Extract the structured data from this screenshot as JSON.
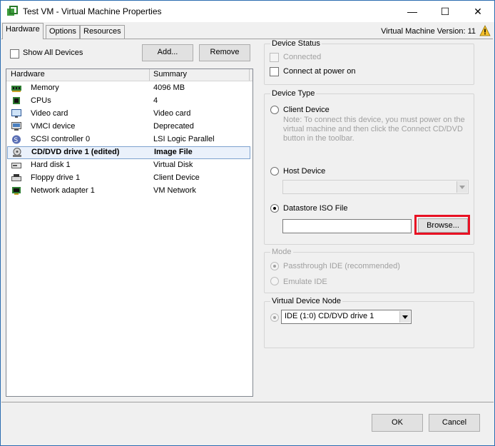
{
  "window": {
    "title": "Test VM - Virtual Machine Properties",
    "minimize_glyph": "—",
    "maximize_glyph": "☐",
    "close_glyph": "✕"
  },
  "tabs": [
    {
      "label": "Hardware",
      "active": true
    },
    {
      "label": "Options",
      "active": false
    },
    {
      "label": "Resources",
      "active": false
    }
  ],
  "vm_version": "Virtual Machine Version: 11",
  "hardware": {
    "show_all_devices_label": "Show All Devices",
    "add_button": "Add...",
    "remove_button": "Remove",
    "columns": [
      "Hardware",
      "Summary"
    ],
    "devices": [
      {
        "name": "Memory",
        "summary": "4096 MB",
        "icon": "memory-icon"
      },
      {
        "name": "CPUs",
        "summary": "4",
        "icon": "cpu-icon"
      },
      {
        "name": "Video card",
        "summary": "Video card",
        "icon": "monitor-icon"
      },
      {
        "name": "VMCI device",
        "summary": "Deprecated",
        "icon": "vmci-icon"
      },
      {
        "name": "SCSI controller 0",
        "summary": "LSI Logic Parallel",
        "icon": "scsi-icon"
      },
      {
        "name": "CD/DVD drive 1 (edited)",
        "summary": "Image File",
        "icon": "cd-drive-icon",
        "selected": true
      },
      {
        "name": "Hard disk 1",
        "summary": "Virtual Disk",
        "icon": "hard-disk-icon"
      },
      {
        "name": "Floppy drive 1",
        "summary": "Client Device",
        "icon": "floppy-icon"
      },
      {
        "name": "Network adapter 1",
        "summary": "VM Network",
        "icon": "network-icon"
      }
    ]
  },
  "device_status": {
    "title": "Device Status",
    "connected_label": "Connected",
    "connect_at_power_on_label": "Connect at power on"
  },
  "device_type": {
    "title": "Device Type",
    "client_device_label": "Client Device",
    "client_note": "Note: To connect this device, you must power on the virtual machine and then click the Connect CD/DVD button in the toolbar.",
    "host_device_label": "Host Device",
    "host_device_value": "",
    "datastore_iso_label": "Datastore ISO File",
    "iso_path_value": "",
    "browse_button": "Browse..."
  },
  "mode": {
    "title": "Mode",
    "passthrough_label": "Passthrough IDE (recommended)",
    "emulate_label": "Emulate IDE"
  },
  "virtual_device_node": {
    "title": "Virtual Device Node",
    "selected": "IDE (1:0) CD/DVD drive 1"
  },
  "footer": {
    "ok_button": "OK",
    "cancel_button": "Cancel"
  },
  "colors": {
    "highlight_border": "#e81123",
    "selection_bg": "#eaf1fb",
    "warning": "#f7c12b"
  }
}
